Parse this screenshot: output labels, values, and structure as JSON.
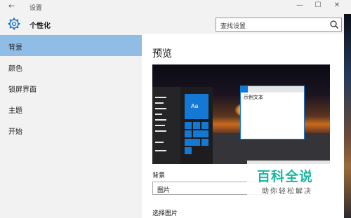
{
  "window": {
    "title": "设置",
    "back_glyph": "←",
    "minimize_glyph": "—",
    "maximize_glyph": "☐",
    "close_glyph": "✕"
  },
  "header": {
    "icon": "gear-icon",
    "title": "个性化",
    "search_placeholder": "查找设置",
    "search_icon": "search-icon"
  },
  "sidebar": {
    "items": [
      {
        "label": "背景",
        "active": true
      },
      {
        "label": "颜色",
        "active": false
      },
      {
        "label": "锁屏界面",
        "active": false
      },
      {
        "label": "主题",
        "active": false
      },
      {
        "label": "开始",
        "active": false
      }
    ]
  },
  "main": {
    "preview_title": "预览",
    "preview": {
      "tile_label": "Aa",
      "sample_text": "示例文本"
    },
    "background_label": "背景",
    "background_value": "图片",
    "choose_picture_label": "选择图片"
  },
  "watermark": {
    "title": "百科全说",
    "subtitle": "助你轻松解决"
  },
  "colors": {
    "accent": "#1479d4",
    "nav_active": "#8fbde6",
    "chrome": "#f2f2f2",
    "watermark": "#1fb6a0"
  }
}
